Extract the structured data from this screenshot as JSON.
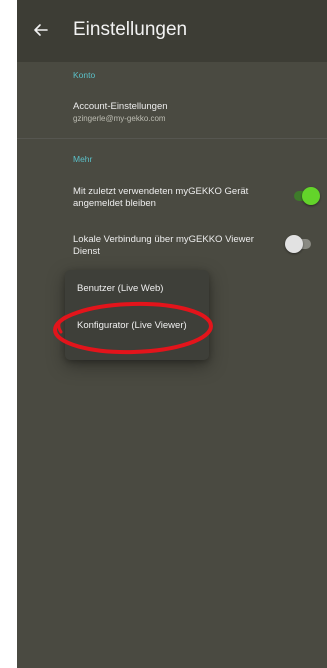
{
  "appbar": {
    "title": "Einstellungen",
    "back_icon": "arrow-left-icon"
  },
  "sections": {
    "konto": {
      "label": "Konto",
      "account": {
        "title": "Account-Einstellungen",
        "subtitle": "gzingerle@my-gekko.com"
      }
    },
    "mehr": {
      "label": "Mehr",
      "stay_logged_in": {
        "title": "Mit zuletzt verwendeten myGEKKO Gerät angemeldet bleiben",
        "enabled": true
      },
      "local_connection": {
        "title": "Lokale Verbindung über myGEKKO Viewer Dienst",
        "enabled": false
      }
    }
  },
  "menu": {
    "items": [
      {
        "label": "Benutzer (Live Web)"
      },
      {
        "label": "Konfigurator (Live Viewer)"
      }
    ]
  },
  "colors": {
    "background": "#4a4a41",
    "appbar": "#3d3d35",
    "accent": "#5bc0c8",
    "switch_on_thumb": "#63d42a",
    "switch_on_track": "#3e7a2a",
    "switch_off_thumb": "#e2e2e2",
    "switch_off_track": "#8a8a83",
    "highlight": "#e3141b"
  }
}
